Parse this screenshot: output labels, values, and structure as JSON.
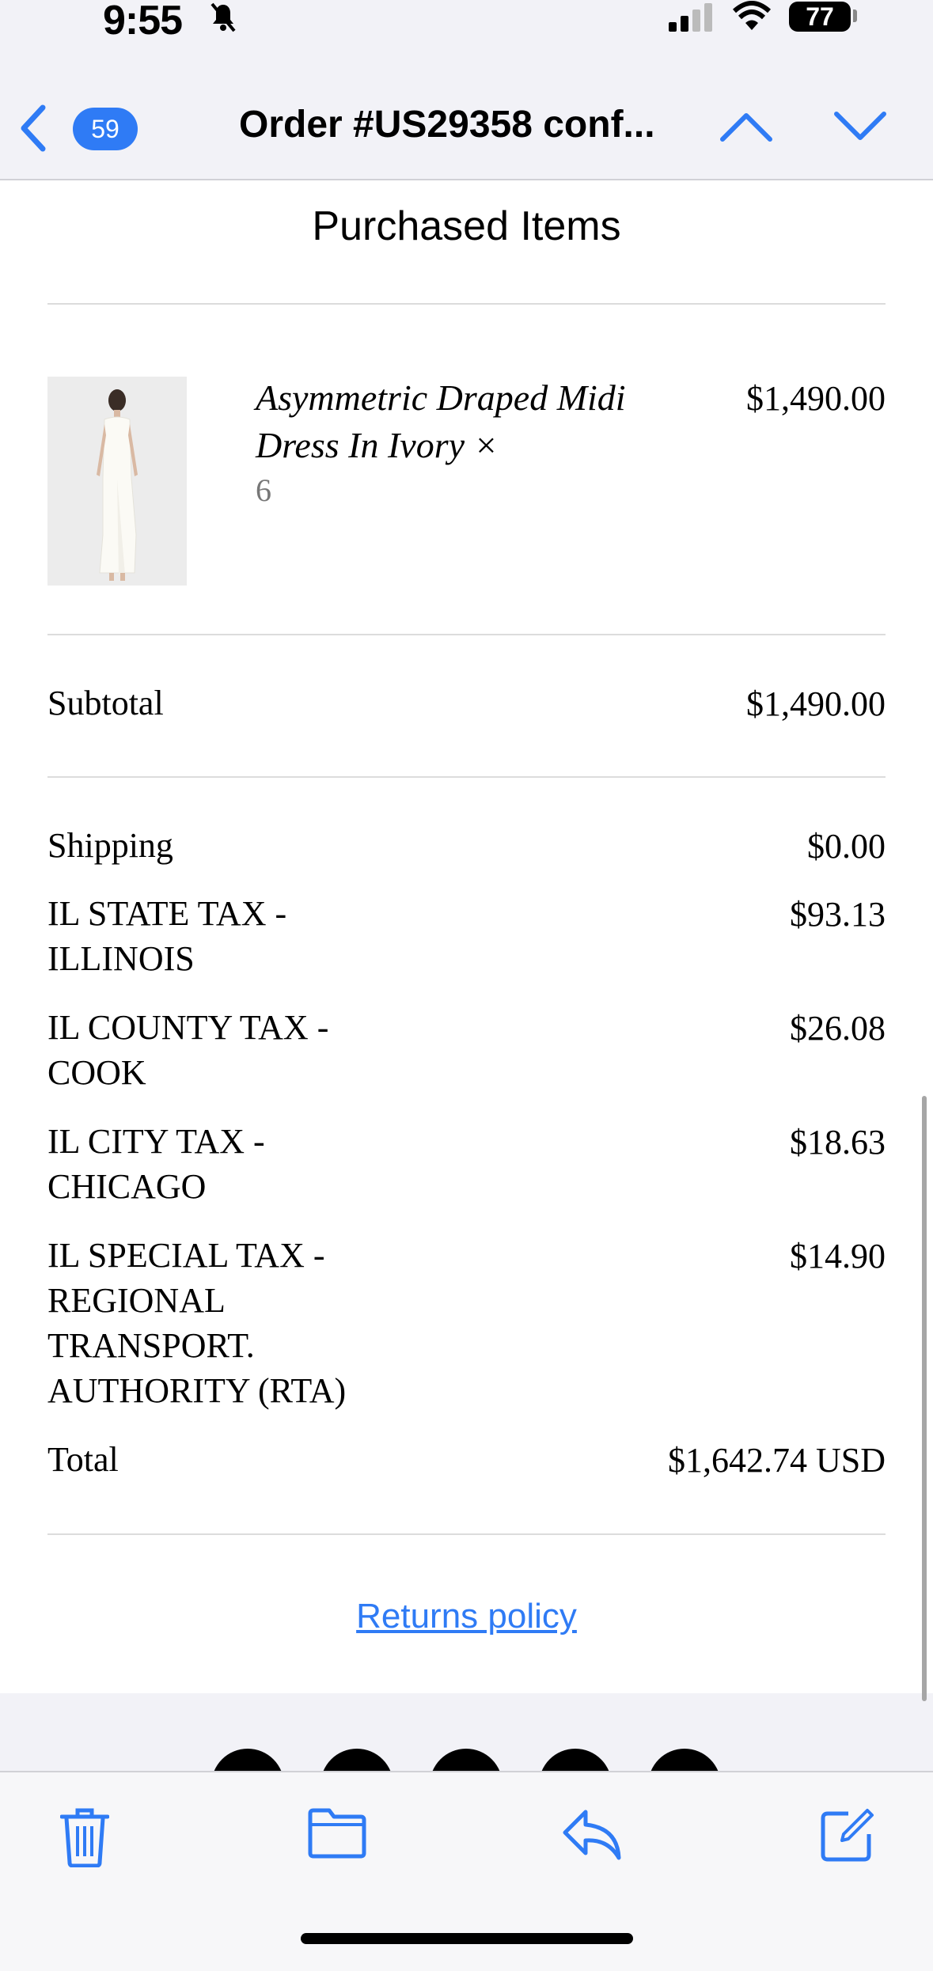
{
  "status_bar": {
    "time": "9:55",
    "battery": "77"
  },
  "nav": {
    "badge_count": "59",
    "subject": "Order #US29358 conf..."
  },
  "email": {
    "section_title": "Purchased Items",
    "item": {
      "name": "Asymmetric Draped Midi Dress In Ivory ×",
      "quantity": "6",
      "price": "$1,490.00"
    },
    "subtotal": {
      "label": "Subtotal",
      "value": "$1,490.00"
    },
    "shipping": {
      "label": "Shipping",
      "value": "$0.00"
    },
    "state_tax": {
      "label_line1": "IL STATE TAX -",
      "label_line2": "ILLINOIS",
      "value": "$93.13"
    },
    "county_tax": {
      "label_line1": "IL COUNTY TAX -",
      "label_line2": "COOK",
      "value": "$26.08"
    },
    "city_tax": {
      "label_line1": "IL CITY TAX -",
      "label_line2": "CHICAGO",
      "value": "$18.63"
    },
    "special_tax": {
      "label_line1": "IL SPECIAL TAX -",
      "label_line2": "REGIONAL",
      "label_line3": "TRANSPORT.",
      "label_line4": "AUTHORITY (RTA)",
      "value": "$14.90"
    },
    "total": {
      "label": "Total",
      "value": "$1,642.74 USD"
    },
    "returns_link": "Returns policy"
  },
  "toolbar": {
    "icons": [
      "trash-icon",
      "folder-icon",
      "reply-icon",
      "compose-icon"
    ]
  },
  "colors": {
    "accent": "#2f7bf5",
    "text": "#000000",
    "background": "#f2f2f7"
  }
}
